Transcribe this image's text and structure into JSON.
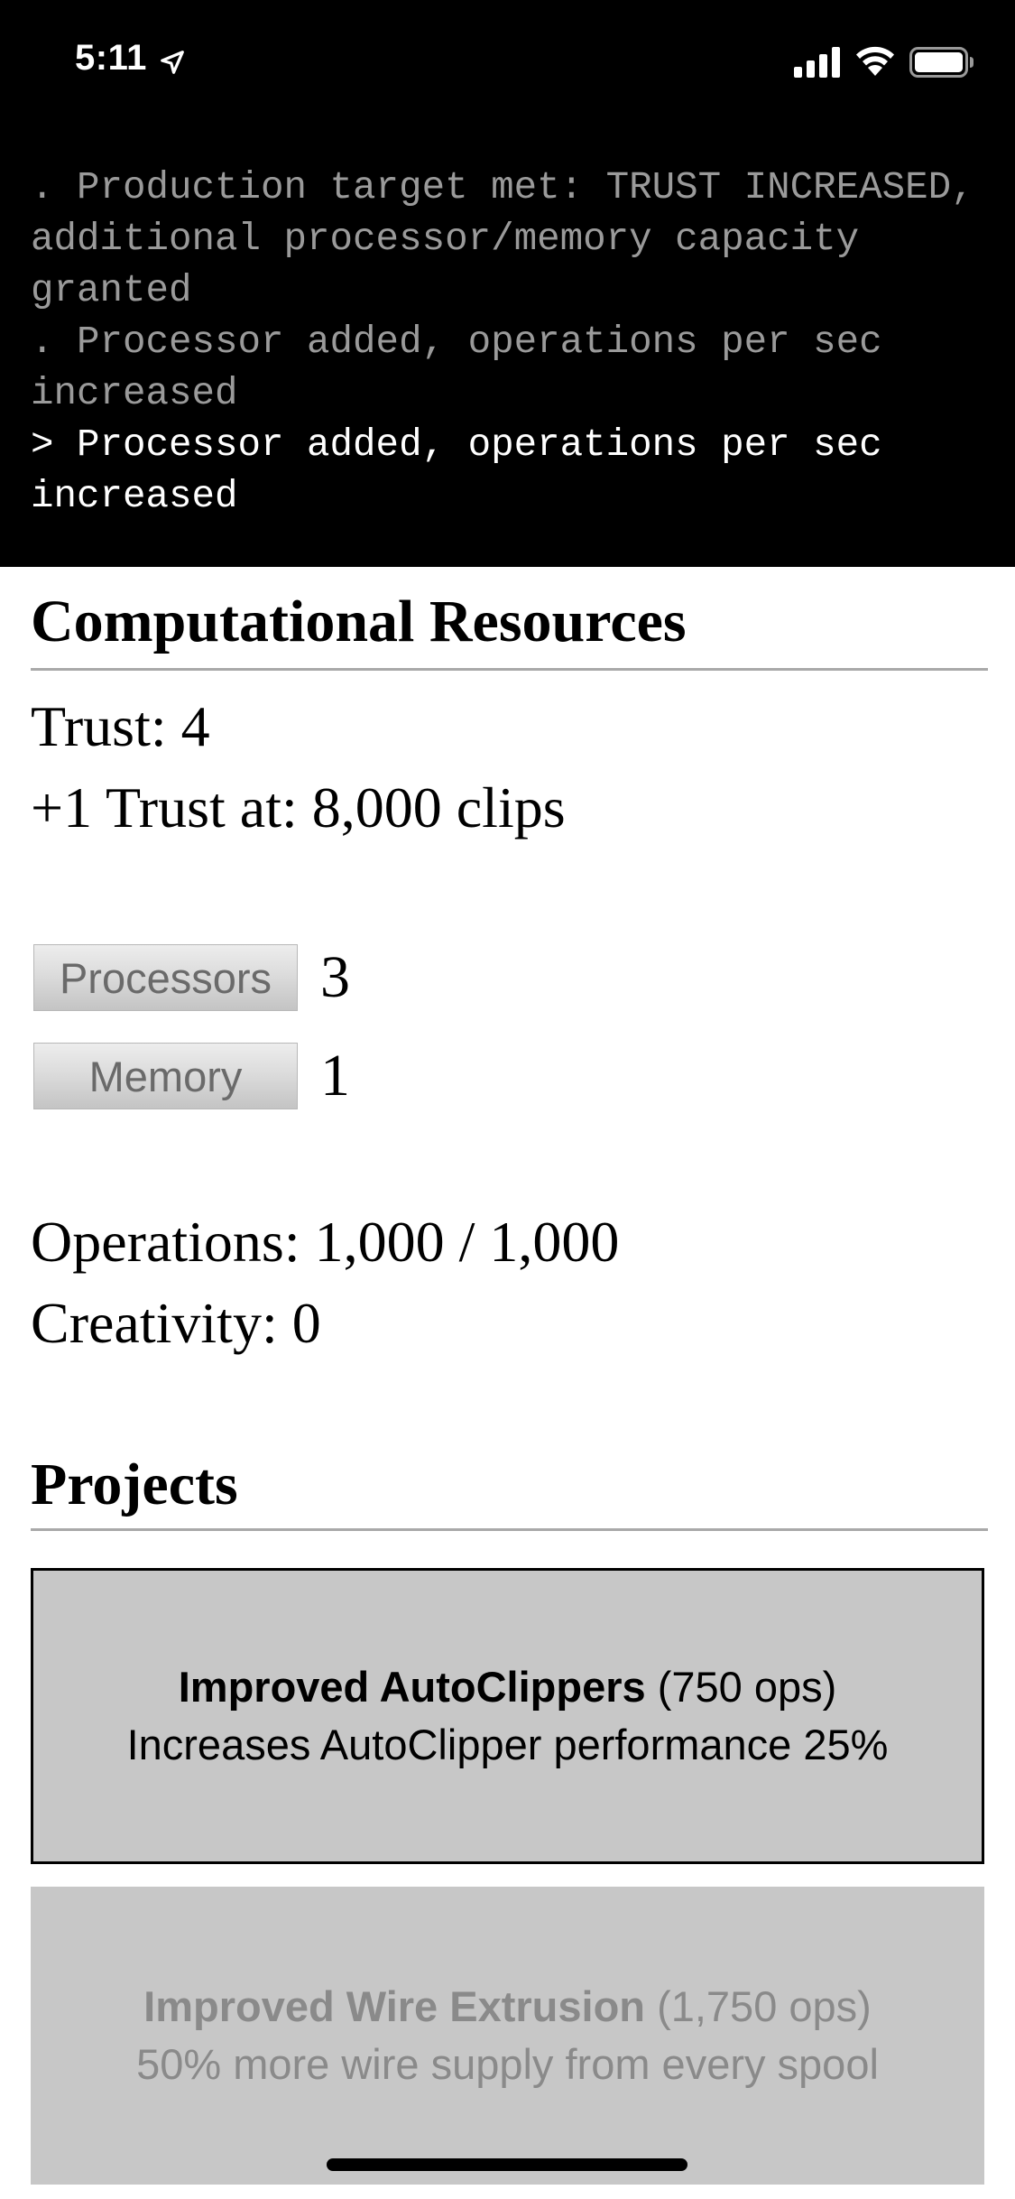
{
  "status_bar": {
    "time": "5:11",
    "icons": [
      "location-arrow-icon",
      "cellular-signal-icon",
      "wifi-icon",
      "battery-icon"
    ]
  },
  "console": {
    "lines": [
      {
        "text": ". Production target met: TRUST INCREASED, additional processor/memory capacity granted",
        "style": "old"
      },
      {
        "text": ". Processor added, operations per sec increased",
        "style": "old"
      },
      {
        "text": "> Processor added, operations per sec increased",
        "style": "current"
      }
    ]
  },
  "computational_resources": {
    "heading": "Computational Resources",
    "trust_label": "Trust: 4",
    "next_trust_label": "+1 Trust at: 8,000 clips",
    "processors": {
      "button_label": "Processors",
      "value": "3"
    },
    "memory": {
      "button_label": "Memory",
      "value": "1"
    },
    "operations_label": "Operations: 1,000 / 1,000",
    "creativity_label": "Creativity: 0"
  },
  "projects": {
    "heading": "Projects",
    "items": [
      {
        "title": "Improved AutoClippers",
        "cost": " (750 ops)",
        "description": "Increases AutoClipper performance 25%",
        "state": "active"
      },
      {
        "title": "Improved Wire Extrusion",
        "cost": " (1,750 ops)",
        "description": "50% more wire supply from every spool",
        "state": "disabled"
      }
    ]
  },
  "colors": {
    "console_bg": "#000000",
    "console_old_text": "#9a9a9a",
    "console_current_text": "#ffffff",
    "project_bg": "#c7c7c7",
    "rule": "#a9a9a9"
  }
}
